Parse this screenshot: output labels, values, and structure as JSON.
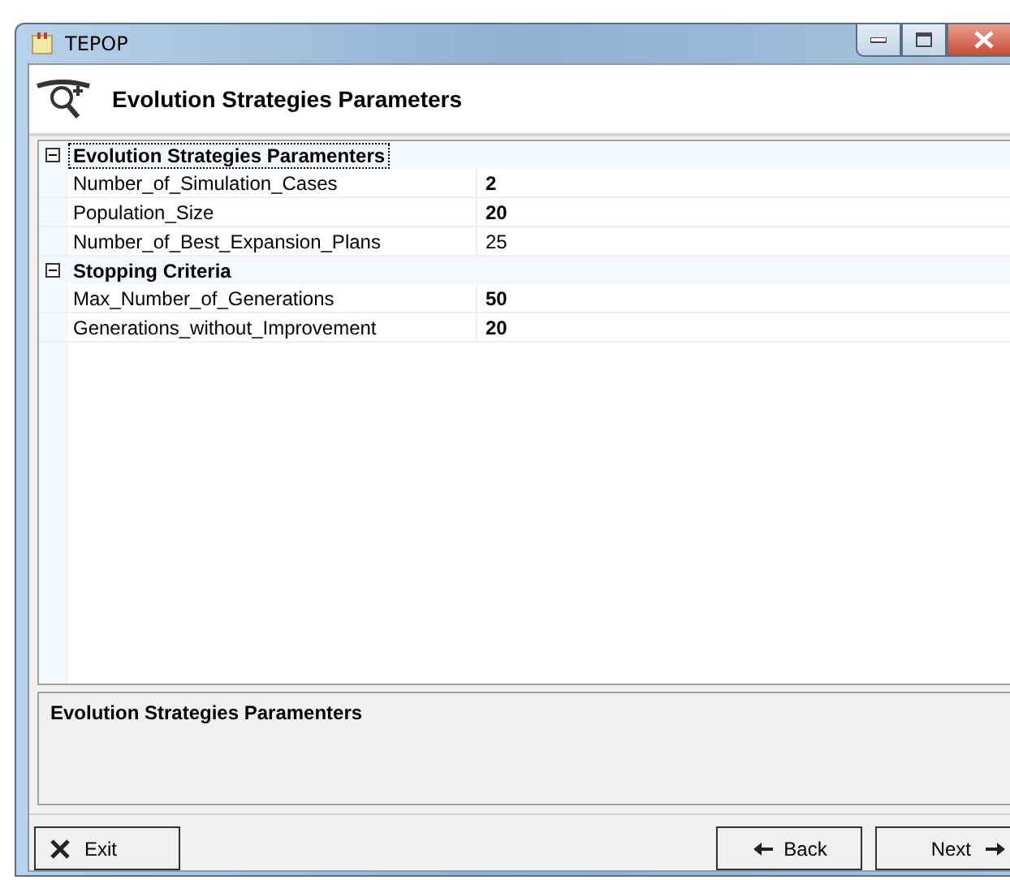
{
  "window": {
    "title": "TEPOP"
  },
  "header": {
    "title": "Evolution Strategies Parameters"
  },
  "property_grid": {
    "categories": [
      {
        "name": "Evolution Strategies Paramenters",
        "expanded": true,
        "selected": true,
        "properties": [
          {
            "name": "Number_of_Simulation_Cases",
            "value": "2",
            "changed": true
          },
          {
            "name": "Population_Size",
            "value": "20",
            "changed": true
          },
          {
            "name": "Number_of_Best_Expansion_Plans",
            "value": "25",
            "changed": false
          }
        ]
      },
      {
        "name": "Stopping Criteria",
        "expanded": true,
        "selected": false,
        "properties": [
          {
            "name": "Max_Number_of_Generations",
            "value": "50",
            "changed": true
          },
          {
            "name": "Generations_without_Improvement",
            "value": "20",
            "changed": true
          }
        ]
      }
    ]
  },
  "description": {
    "title": "Evolution Strategies Paramenters"
  },
  "buttons": [
    {
      "kind": "exit",
      "label": "Exit"
    },
    {
      "kind": "back",
      "label": "Back"
    },
    {
      "kind": "next",
      "label": "Next"
    }
  ]
}
